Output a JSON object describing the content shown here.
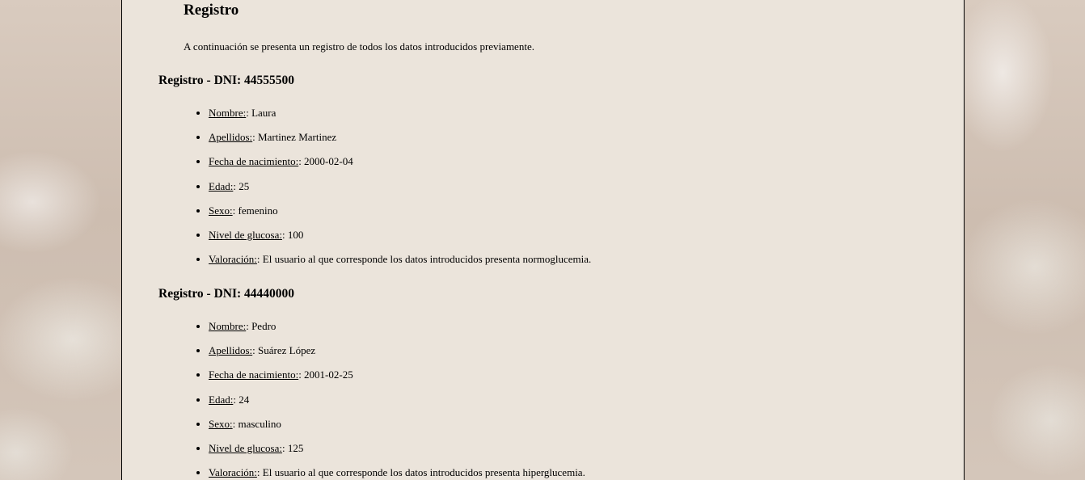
{
  "page": {
    "title": "Registro",
    "intro": "A continuación se presenta un registro de todos los datos introducidos previamente."
  },
  "records": [
    {
      "title": "Registro - DNI: 44555500",
      "fields": [
        {
          "label": "Nombre:",
          "value": ": Laura"
        },
        {
          "label": "Apellidos:",
          "value": ": Martinez Martinez"
        },
        {
          "label": "Fecha de nacimiento:",
          "value": ": 2000-02-04"
        },
        {
          "label": "Edad:",
          "value": ": 25"
        },
        {
          "label": "Sexo:",
          "value": ": femenino"
        },
        {
          "label": "Nivel de glucosa:",
          "value": ": 100"
        },
        {
          "label": "Valoración:",
          "value": ": El usuario al que corresponde los datos introducidos presenta normoglucemia."
        }
      ]
    },
    {
      "title": "Registro - DNI: 44440000",
      "fields": [
        {
          "label": "Nombre:",
          "value": ": Pedro"
        },
        {
          "label": "Apellidos:",
          "value": ": Suárez López"
        },
        {
          "label": "Fecha de nacimiento:",
          "value": ": 2001-02-25"
        },
        {
          "label": "Edad:",
          "value": ": 24"
        },
        {
          "label": "Sexo:",
          "value": ": masculino"
        },
        {
          "label": "Nivel de glucosa:",
          "value": ": 125"
        },
        {
          "label": "Valoración:",
          "value": ": El usuario al que corresponde los datos introducidos presenta hiperglucemia."
        }
      ]
    }
  ]
}
